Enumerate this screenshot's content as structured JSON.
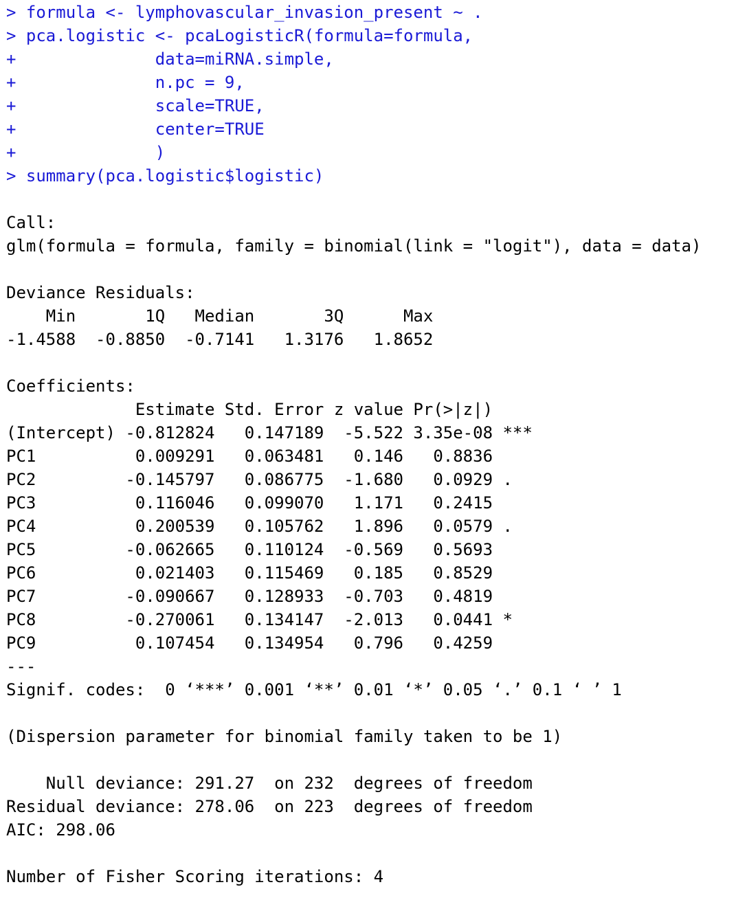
{
  "colors": {
    "input_text": "#1a1ad6",
    "output_text": "#000000",
    "background": "#ffffff"
  },
  "input_lines": [
    "> formula <- lymphovascular_invasion_present ~ .",
    "> pca.logistic <- pcaLogisticR(formula=formula,",
    "+              data=miRNA.simple,",
    "+              n.pc = 9,",
    "+              scale=TRUE,",
    "+              center=TRUE",
    "+              )",
    "> summary(pca.logistic$logistic)"
  ],
  "output_lines": [
    "",
    "Call:",
    "glm(formula = formula, family = binomial(link = \"logit\"), data = data)",
    "",
    "Deviance Residuals:",
    "    Min       1Q   Median       3Q      Max  ",
    "-1.4588  -0.8850  -0.7141   1.3176   1.8652  ",
    "",
    "Coefficients:",
    "             Estimate Std. Error z value Pr(>|z|)    ",
    "(Intercept) -0.812824   0.147189  -5.522 3.35e-08 ***",
    "PC1          0.009291   0.063481   0.146   0.8836    ",
    "PC2         -0.145797   0.086775  -1.680   0.0929 .  ",
    "PC3          0.116046   0.099070   1.171   0.2415    ",
    "PC4          0.200539   0.105762   1.896   0.0579 .  ",
    "PC5         -0.062665   0.110124  -0.569   0.5693    ",
    "PC6          0.021403   0.115469   0.185   0.8529    ",
    "PC7         -0.090667   0.128933  -0.703   0.4819    ",
    "PC8         -0.270061   0.134147  -2.013   0.0441 *  ",
    "PC9          0.107454   0.134954   0.796   0.4259    ",
    "---",
    "Signif. codes:  0 ‘***’ 0.001 ‘**’ 0.01 ‘*’ 0.05 ‘.’ 0.1 ‘ ’ 1",
    "",
    "(Dispersion parameter for binomial family taken to be 1)",
    "",
    "    Null deviance: 291.27  on 232  degrees of freedom",
    "Residual deviance: 278.06  on 223  degrees of freedom",
    "AIC: 298.06",
    "",
    "Number of Fisher Scoring iterations: 4"
  ]
}
